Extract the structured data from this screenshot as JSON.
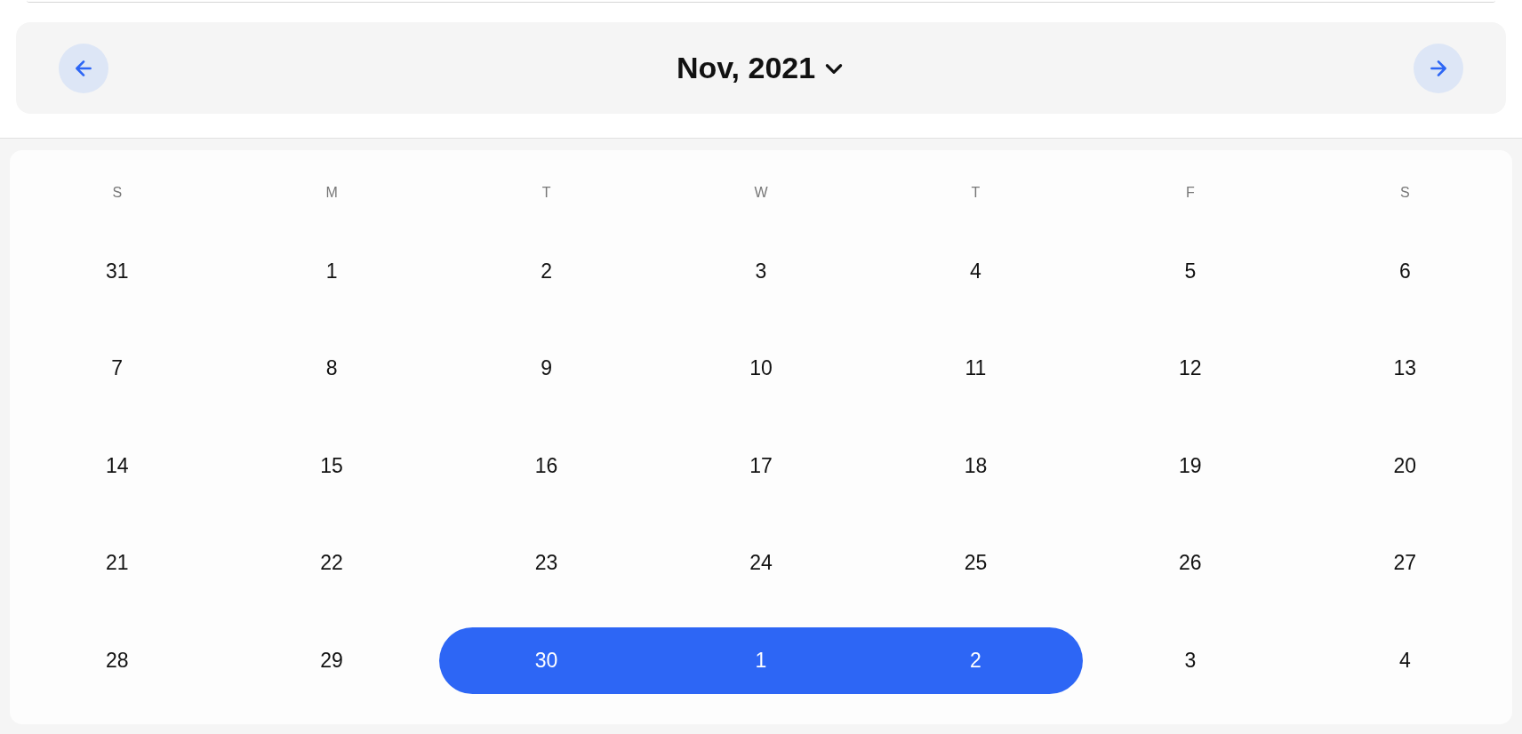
{
  "header": {
    "month": "Nov, 2021"
  },
  "weekdays": [
    "S",
    "M",
    "T",
    "W",
    "T",
    "F",
    "S"
  ],
  "weeks": [
    [
      {
        "day": "31",
        "selected": false
      },
      {
        "day": "1",
        "selected": false
      },
      {
        "day": "2",
        "selected": false
      },
      {
        "day": "3",
        "selected": false
      },
      {
        "day": "4",
        "selected": false
      },
      {
        "day": "5",
        "selected": false
      },
      {
        "day": "6",
        "selected": false
      }
    ],
    [
      {
        "day": "7",
        "selected": false
      },
      {
        "day": "8",
        "selected": false
      },
      {
        "day": "9",
        "selected": false
      },
      {
        "day": "10",
        "selected": false
      },
      {
        "day": "11",
        "selected": false
      },
      {
        "day": "12",
        "selected": false
      },
      {
        "day": "13",
        "selected": false
      }
    ],
    [
      {
        "day": "14",
        "selected": false
      },
      {
        "day": "15",
        "selected": false
      },
      {
        "day": "16",
        "selected": false
      },
      {
        "day": "17",
        "selected": false
      },
      {
        "day": "18",
        "selected": false
      },
      {
        "day": "19",
        "selected": false
      },
      {
        "day": "20",
        "selected": false
      }
    ],
    [
      {
        "day": "21",
        "selected": false
      },
      {
        "day": "22",
        "selected": false
      },
      {
        "day": "23",
        "selected": false
      },
      {
        "day": "24",
        "selected": false
      },
      {
        "day": "25",
        "selected": false
      },
      {
        "day": "26",
        "selected": false
      },
      {
        "day": "27",
        "selected": false
      }
    ],
    [
      {
        "day": "28",
        "selected": false
      },
      {
        "day": "29",
        "selected": false
      },
      {
        "day": "30",
        "selected": true
      },
      {
        "day": "1",
        "selected": true
      },
      {
        "day": "2",
        "selected": true
      },
      {
        "day": "3",
        "selected": false
      },
      {
        "day": "4",
        "selected": false
      }
    ]
  ]
}
